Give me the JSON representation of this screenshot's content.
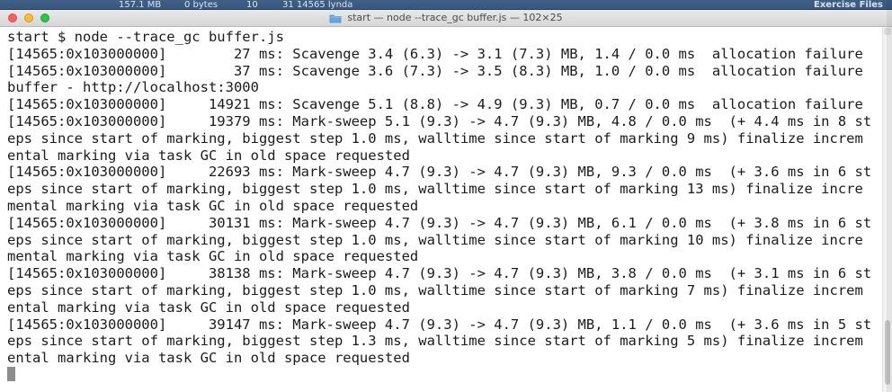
{
  "background": {
    "row_memory": "157.1 MB",
    "row_bytes": "0 bytes",
    "row_count": "10",
    "row_process": "31  14565  lynda",
    "exercise_files_label": "Exercise Files"
  },
  "window": {
    "title": "start — node --trace_gc buffer.js — 102×25"
  },
  "terminal": {
    "lines": [
      "start $ node --trace_gc buffer.js",
      "[14565:0x103000000]        27 ms: Scavenge 3.4 (6.3) -> 3.1 (7.3) MB, 1.4 / 0.0 ms  allocation failure",
      "[14565:0x103000000]        37 ms: Scavenge 3.6 (7.3) -> 3.5 (8.3) MB, 1.0 / 0.0 ms  allocation failure",
      "buffer - http://localhost:3000",
      "[14565:0x103000000]     14921 ms: Scavenge 5.1 (8.8) -> 4.9 (9.3) MB, 0.7 / 0.0 ms  allocation failure",
      "[14565:0x103000000]     19379 ms: Mark-sweep 5.1 (9.3) -> 4.7 (9.3) MB, 4.8 / 0.0 ms  (+ 4.4 ms in 8 st",
      "eps since start of marking, biggest step 1.0 ms, walltime since start of marking 9 ms) finalize increm",
      "ental marking via task GC in old space requested",
      "[14565:0x103000000]     22693 ms: Mark-sweep 4.7 (9.3) -> 4.7 (9.3) MB, 9.3 / 0.0 ms  (+ 3.6 ms in 6 st",
      "eps since start of marking, biggest step 1.0 ms, walltime since start of marking 13 ms) finalize incre",
      "mental marking via task GC in old space requested",
      "[14565:0x103000000]     30131 ms: Mark-sweep 4.7 (9.3) -> 4.7 (9.3) MB, 6.1 / 0.0 ms  (+ 3.8 ms in 6 st",
      "eps since start of marking, biggest step 1.0 ms, walltime since start of marking 10 ms) finalize incre",
      "mental marking via task GC in old space requested",
      "[14565:0x103000000]     38138 ms: Mark-sweep 4.7 (9.3) -> 4.7 (9.3) MB, 3.8 / 0.0 ms  (+ 3.1 ms in 6 st",
      "eps since start of marking, biggest step 1.0 ms, walltime since start of marking 7 ms) finalize increm",
      "ental marking via task GC in old space requested",
      "[14565:0x103000000]     39147 ms: Mark-sweep 4.7 (9.3) -> 4.7 (9.3) MB, 1.1 / 0.0 ms  (+ 3.6 ms in 5 st",
      "eps since start of marking, biggest step 1.3 ms, walltime since start of marking 5 ms) finalize increm",
      "ental marking via task GC in old space requested"
    ]
  },
  "colors": {
    "desktop": "#2f4f77",
    "terminal_bg": "#ffffff",
    "text": "#1b1b1b",
    "cursor": "#8d8d8d",
    "close": "#ff5f57",
    "minimize": "#febc2e",
    "maximize": "#28c840"
  },
  "icons": {
    "window_title": "folder-icon"
  }
}
